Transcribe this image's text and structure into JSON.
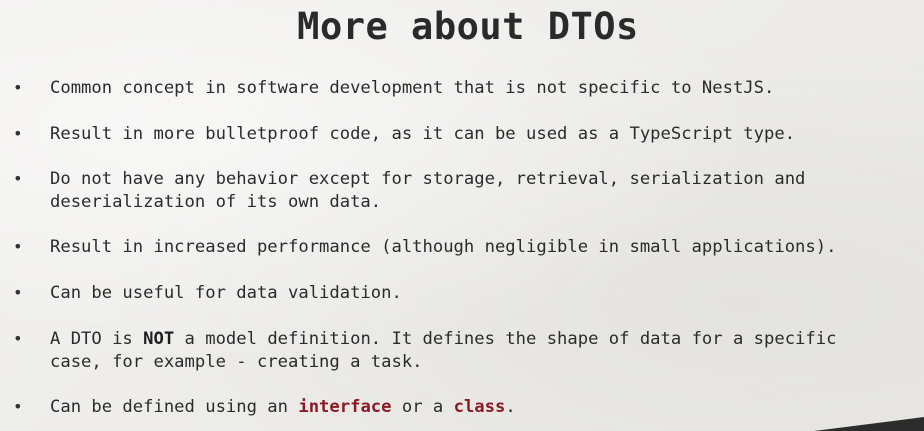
{
  "slide": {
    "title": "More about DTOs",
    "bullets": [
      {
        "text": "Common concept in software development that is not specific to NestJS."
      },
      {
        "text": "Result in more bulletproof code, as it can be used as a TypeScript type."
      },
      {
        "line1": "Do not have any behavior except for storage, retrieval, serialization and",
        "line2": "deserialization of its own data."
      },
      {
        "text": "Result in increased performance (although negligible in small applications)."
      },
      {
        "text": "Can be useful for data validation."
      },
      {
        "pre": "A DTO is ",
        "strong": "NOT",
        "post": " a model definition. It defines the shape of data for a specific",
        "line2": "case, for example - creating a task."
      },
      {
        "pre": "Can be defined using an ",
        "kw1": "interface",
        "mid": " or a ",
        "kw2": "class",
        "post": "."
      }
    ],
    "bullet_symbol": "•",
    "keyword_color": "#8b1a24"
  }
}
